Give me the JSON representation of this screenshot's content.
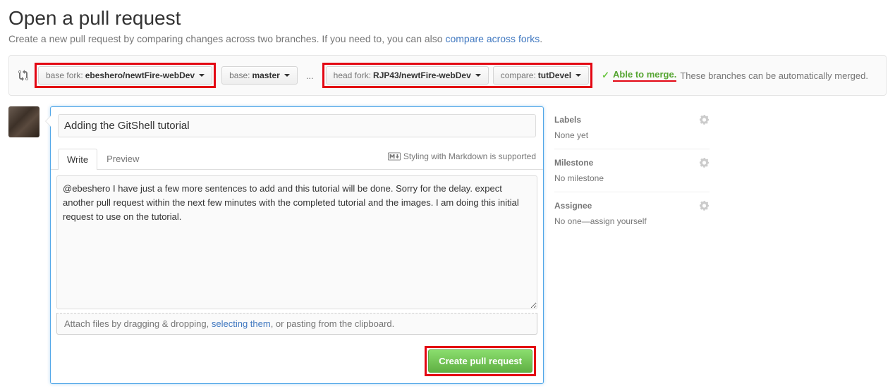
{
  "header": {
    "title": "Open a pull request",
    "subtitle_prefix": "Create a new pull request by comparing changes across two branches. If you need to, you can also ",
    "subtitle_link": "compare across forks",
    "subtitle_suffix": "."
  },
  "range": {
    "base_fork_label": "base fork:",
    "base_fork_value": "ebeshero/newtFire-webDev",
    "base_label": "base:",
    "base_value": "master",
    "ellipsis": "...",
    "head_fork_label": "head fork:",
    "head_fork_value": "RJP43/newtFire-webDev",
    "compare_label": "compare:",
    "compare_value": "tutDevel",
    "merge_able": "Able to merge.",
    "merge_msg": "These branches can be automatically merged."
  },
  "form": {
    "title_value": "Adding the GitShell tutorial",
    "tab_write": "Write",
    "tab_preview": "Preview",
    "markdown_hint": "Styling with Markdown is supported",
    "body_value": "@ebeshero I have just a few more sentences to add and this tutorial will be done. Sorry for the delay. expect another pull request within the next few minutes with the completed tutorial and the images. I am doing this initial request to use on the tutorial.",
    "attach_prefix": "Attach files by dragging & dropping, ",
    "attach_link": "selecting them",
    "attach_suffix": ", or pasting from the clipboard.",
    "submit": "Create pull request"
  },
  "sidebar": {
    "labels_title": "Labels",
    "labels_value": "None yet",
    "milestone_title": "Milestone",
    "milestone_value": "No milestone",
    "assignee_title": "Assignee",
    "assignee_value": "No one—assign yourself"
  }
}
